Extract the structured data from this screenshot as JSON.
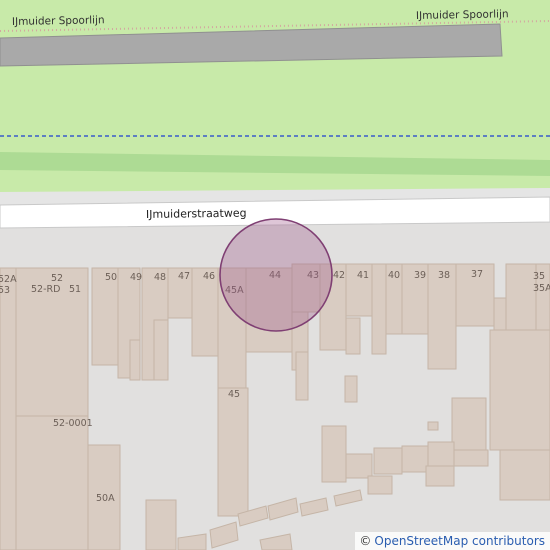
{
  "map": {
    "labels": {
      "railway_left": "IJmuider Spoorlijn",
      "railway_right": "IJmuider Spoorlijn",
      "street": "IJmuiderstraatweg"
    },
    "house_numbers": [
      "52A",
      "53",
      "52",
      "52-RD",
      "51",
      "50",
      "49",
      "48",
      "47",
      "46",
      "45A",
      "44",
      "43",
      "42",
      "41",
      "40",
      "39",
      "38",
      "37",
      "35",
      "35A",
      "45",
      "52-0001",
      "50A"
    ],
    "colors": {
      "park": "#c8eaa9",
      "railway_area": "#e0e0e0",
      "road": "#ffffff",
      "residential": "#e1e0df",
      "building": "#d9ccc2",
      "building_outline": "#c5b5a7",
      "marker_fill": "#a05c8c",
      "marker_stroke": "#7f3f73",
      "boundary": "#1d3fd2"
    }
  },
  "attribution": {
    "symbol": "©",
    "text": "OpenStreetMap contributors"
  }
}
